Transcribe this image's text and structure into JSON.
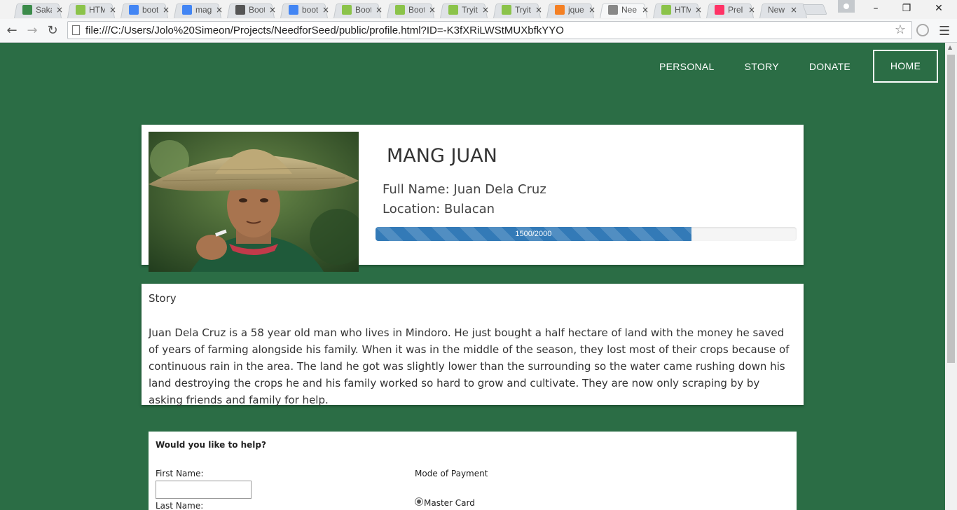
{
  "browser": {
    "tabs": [
      {
        "label": "Saka",
        "favicon": "bus-icon",
        "color": "#3b8b4a"
      },
      {
        "label": "HTML",
        "favicon": "w3schools-icon",
        "color": "#8bc34a"
      },
      {
        "label": "boot",
        "favicon": "google-icon",
        "color": "#4285f4"
      },
      {
        "label": "mag",
        "favicon": "google-icon",
        "color": "#4285f4"
      },
      {
        "label": "Boot",
        "favicon": "bootstrap-icon",
        "color": "#555555"
      },
      {
        "label": "boot",
        "favicon": "google-icon",
        "color": "#4285f4"
      },
      {
        "label": "Boot",
        "favicon": "w3schools-icon",
        "color": "#8bc34a"
      },
      {
        "label": "Boot",
        "favicon": "w3schools-icon",
        "color": "#8bc34a"
      },
      {
        "label": "Tryit",
        "favicon": "w3schools-icon",
        "color": "#8bc34a"
      },
      {
        "label": "Tryit",
        "favicon": "w3schools-icon",
        "color": "#8bc34a"
      },
      {
        "label": "jque",
        "favicon": "stackoverflow-icon",
        "color": "#f48024"
      },
      {
        "label": "Nee",
        "favicon": "page-icon",
        "color": "#888888",
        "active": true
      },
      {
        "label": "HTM",
        "favicon": "w3schools-icon",
        "color": "#8bc34a"
      },
      {
        "label": "Prel",
        "favicon": "invision-icon",
        "color": "#ff3366"
      },
      {
        "label": "New Ta",
        "favicon": "",
        "color": ""
      }
    ],
    "close_glyph": "×",
    "url": "file:///C:/Users/Jolo%20Simeon/Projects/NeedforSeed/public/profile.html?ID=-K3fXRiLWStMUXbfkYYO"
  },
  "nav": {
    "personal": "PERSONAL",
    "story": "STORY",
    "donate": "DONATE",
    "home": "HOME"
  },
  "profile": {
    "name": "MANG JUAN",
    "full_name": "Full Name: Juan Dela Cruz",
    "location": "Location: Bulacan",
    "progress_text": "1500/2000",
    "progress_fraction": 0.75
  },
  "story": {
    "title": "Story",
    "text": "Juan Dela Cruz is a 58 year old man who lives in Mindoro. He just bought a half hectare of land with the money he saved of years of farming alongside his family. When it was in the middle of the season, they lost most of their crops because of continuous rain in the area. The land he got was slightly lower than the surrounding so the water came rushing down his land destroying the crops he and his family worked so hard to grow and cultivate. They are now only scraping by by asking friends and family for help."
  },
  "form": {
    "question": "Would you like to help?",
    "first_name_label": "First Name:",
    "last_name_label": "Last Name:",
    "payment_label": "Mode of Payment",
    "payment_option": "Master Card"
  },
  "colors": {
    "page_bg": "#2b6d45",
    "progress_bar": "#337ab7"
  }
}
